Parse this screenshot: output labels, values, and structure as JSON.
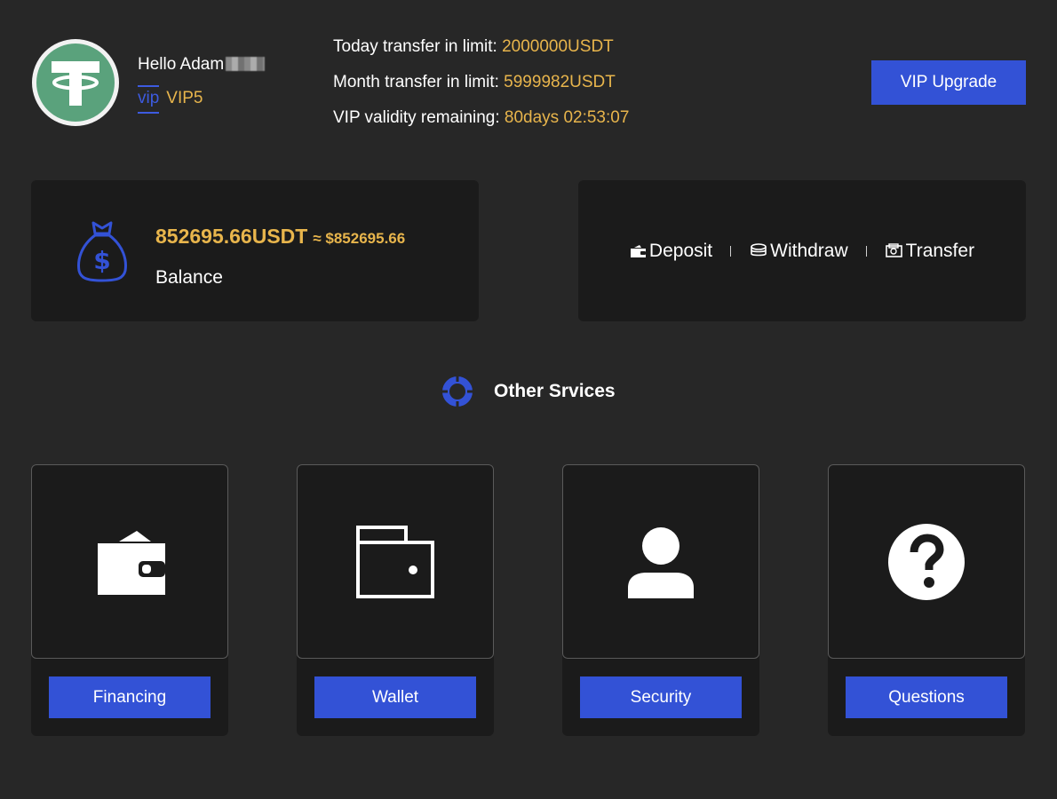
{
  "user": {
    "greeting": "Hello Adam",
    "vip_tag": "vip",
    "vip_level": "VIP5"
  },
  "limits": {
    "today_label": "Today transfer in limit: ",
    "today_value": "2000000USDT",
    "month_label": "Month transfer in limit: ",
    "month_value": "5999982USDT",
    "validity_label": "VIP validity remaining: ",
    "validity_value": "80days 02:53:07"
  },
  "header": {
    "upgrade_button": "VIP Upgrade"
  },
  "balance": {
    "amount": "852695.66USDT",
    "approx": "≈ $852695.66",
    "label": "Balance"
  },
  "actions": {
    "deposit": "Deposit",
    "withdraw": "Withdraw",
    "transfer": "Transfer"
  },
  "services": {
    "title": "Other Srvices",
    "items": [
      {
        "label": "Financing",
        "icon": "wallet-filled-icon"
      },
      {
        "label": "Wallet",
        "icon": "wallet-outline-icon"
      },
      {
        "label": "Security",
        "icon": "user-icon"
      },
      {
        "label": "Questions",
        "icon": "question-icon"
      }
    ]
  },
  "colors": {
    "background": "#272727",
    "panel": "#1b1b1b",
    "accent_blue": "#3352d6",
    "gold": "#e8b54c",
    "tether_green": "#5aa27c"
  }
}
